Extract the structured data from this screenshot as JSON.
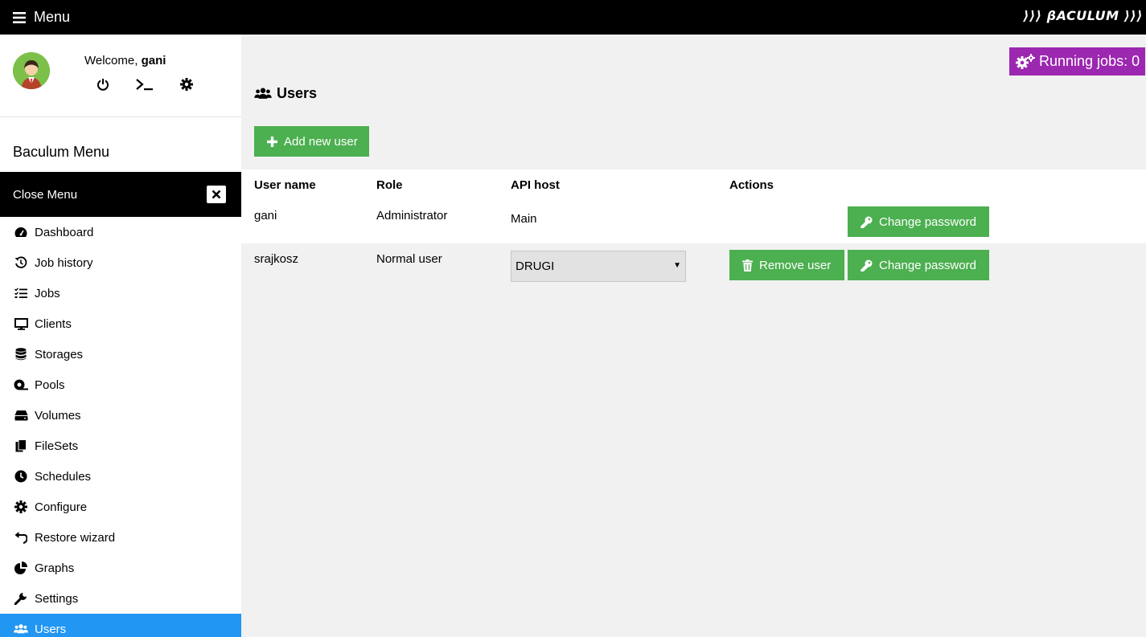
{
  "topbar": {
    "menu_label": "Menu",
    "brand": "⟩⟩⟩ βACULUM ⟩⟩⟩"
  },
  "sidebar": {
    "welcome_prefix": "Welcome,",
    "username": "gani",
    "menu_title": "Baculum Menu",
    "close_label": "Close Menu",
    "items": [
      {
        "label": "Dashboard",
        "icon": "tachometer-icon"
      },
      {
        "label": "Job history",
        "icon": "history-icon"
      },
      {
        "label": "Jobs",
        "icon": "tasks-icon"
      },
      {
        "label": "Clients",
        "icon": "desktop-icon"
      },
      {
        "label": "Storages",
        "icon": "database-icon"
      },
      {
        "label": "Pools",
        "icon": "tape-icon"
      },
      {
        "label": "Volumes",
        "icon": "hdd-icon"
      },
      {
        "label": "FileSets",
        "icon": "copy-icon"
      },
      {
        "label": "Schedules",
        "icon": "clock-icon"
      },
      {
        "label": "Configure",
        "icon": "cog-icon"
      },
      {
        "label": "Restore wizard",
        "icon": "undo-icon"
      },
      {
        "label": "Graphs",
        "icon": "chart-pie-icon"
      },
      {
        "label": "Settings",
        "icon": "wrench-icon"
      },
      {
        "label": "Users",
        "icon": "users-icon",
        "active": true
      }
    ]
  },
  "main": {
    "running_jobs": "Running jobs: 0",
    "title": "Users",
    "add_user": "Add new user",
    "columns": [
      "User name",
      "Role",
      "API host",
      "Actions"
    ],
    "rows": [
      {
        "username": "gani",
        "role": "Administrator",
        "api_host": "Main",
        "change_password": "Change password"
      },
      {
        "username": "srajkosz",
        "role": "Normal user",
        "api_host": "DRUGI",
        "remove_user": "Remove user",
        "change_password": "Change password"
      }
    ]
  },
  "colors": {
    "green": "#4caf50",
    "purple": "#9c27b0",
    "blue": "#2196f3",
    "black": "#000000"
  }
}
